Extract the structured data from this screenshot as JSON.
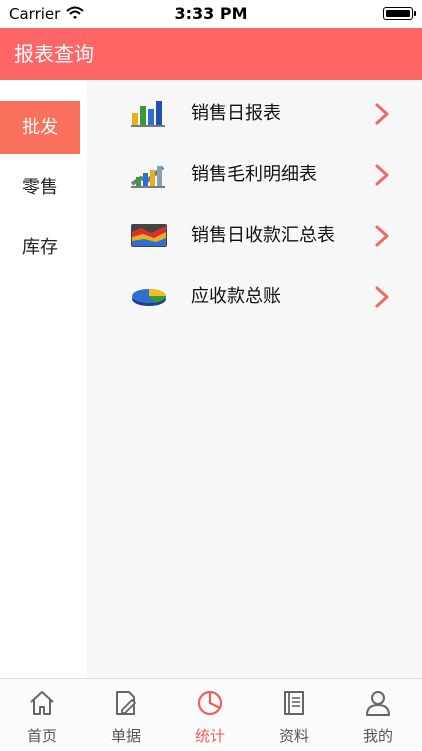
{
  "colors": {
    "accent": "#ff6666",
    "sidebar_active": "#f9705c",
    "chevron": "#f06868",
    "tab_active": "#f25d5d"
  },
  "status_bar": {
    "carrier": "Carrier",
    "time": "3:33 PM"
  },
  "header": {
    "title": "报表查询"
  },
  "sidebar": {
    "items": [
      {
        "label": "批发",
        "active": true
      },
      {
        "label": "零售",
        "active": false
      },
      {
        "label": "库存",
        "active": false
      }
    ]
  },
  "reports": [
    {
      "label": "销售日报表",
      "icon": "bar-chart-icon"
    },
    {
      "label": "销售毛利明细表",
      "icon": "growth-chart-icon"
    },
    {
      "label": "销售日收款汇总表",
      "icon": "area-chart-icon"
    },
    {
      "label": "应收款总账",
      "icon": "pie-chart-icon"
    }
  ],
  "tabbar": {
    "items": [
      {
        "label": "首页",
        "icon": "home-icon",
        "active": false
      },
      {
        "label": "单据",
        "icon": "document-edit-icon",
        "active": false
      },
      {
        "label": "统计",
        "icon": "pie-chart-icon",
        "active": true
      },
      {
        "label": "资料",
        "icon": "book-icon",
        "active": false
      },
      {
        "label": "我的",
        "icon": "user-icon",
        "active": false
      }
    ]
  }
}
